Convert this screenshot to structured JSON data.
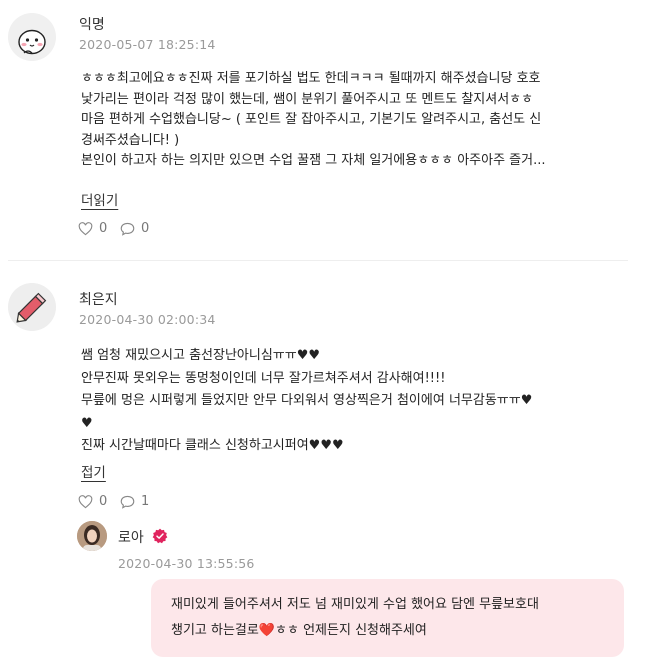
{
  "comments": [
    {
      "author": "익명",
      "date": "2020-05-07 18:25:14",
      "lines": [
        "ㅎㅎㅎ최고에요ㅎㅎ진짜 저를 포기하실 법도 한데ㅋㅋㅋ 될때까지 해주셨습니당 호호",
        "낯가리는 편이라 걱정 많이 했는데, 쌤이 분위기 풀어주시고 또 멘트도 찰지셔서ㅎㅎ",
        "마음 편하게 수업했습니당~ ( 포인트 잘 잡아주시고, 기본기도 알려주시고, 춤선도 신",
        "경써주셨습니다! )",
        "본인이 하고자 하는 의지만 있으면 수업 꿀잼 그 자체 일거에용ㅎㅎㅎ 아주아주 즐거..."
      ],
      "toggle_label": "더읽기",
      "likes": "0",
      "replies": "0"
    },
    {
      "author": "최은지",
      "date": "2020-04-30 02:00:34",
      "lines": [
        "쌤 엄청 재밌으시고 춤선장난아니심ㅠㅠ♥♥",
        "안무진짜 못외우는 똥멍청이인데 너무 잘가르쳐주셔서 감사해여!!!!",
        "무릎에 멍은 시퍼렇게 들었지만 안무 다외워서 영상찍은거 첨이에여 너무감동ㅠㅠ♥",
        "♥",
        "진짜 시간날때마다 클래스 신청하고시퍼여♥♥♥"
      ],
      "toggle_label": "접기",
      "likes": "0",
      "replies": "1"
    }
  ],
  "reply": {
    "author": "로아",
    "date": "2020-04-30 13:55:56",
    "lines": [
      "재미있게 들어주셔서 저도 넘 재미있게 수업 했어요 담엔 무릎보호대",
      "챙기고 하는걸로❤️ㅎㅎ 언제든지 신청해주세여"
    ]
  },
  "colors": {
    "accent": "#e0245e",
    "bubble": "#fde7ea",
    "meta": "#9a9a9a"
  },
  "icons": [
    "anonymous-avatar-icon",
    "pencil-avatar-icon",
    "heart-icon",
    "speech-bubble-icon",
    "verified-badge-icon"
  ]
}
